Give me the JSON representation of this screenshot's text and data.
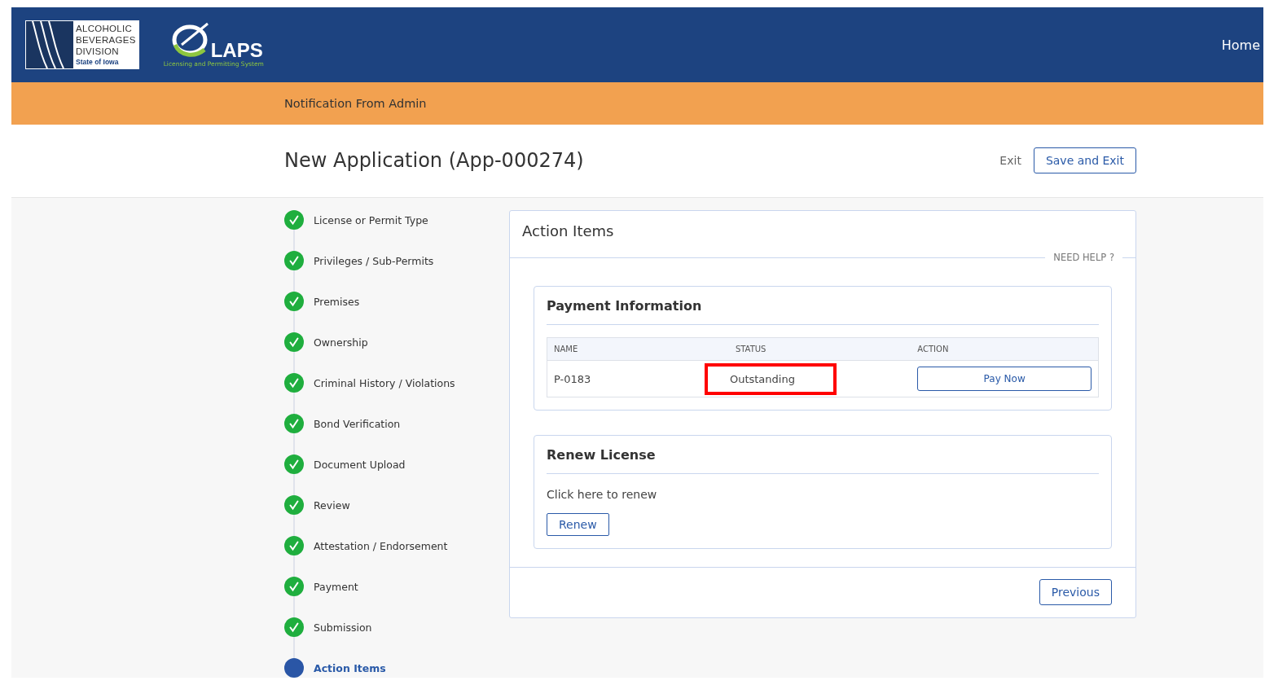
{
  "header": {
    "agency_logo": {
      "lines": [
        "ALCOHOLIC",
        "BEVERAGES",
        "DIVISION"
      ],
      "state": "State of Iowa"
    },
    "laps_logo": {
      "name": "LAPS",
      "tagline": "Licensing and Permitting System"
    },
    "nav": [
      "Home"
    ]
  },
  "notification": "Notification From Admin",
  "page_title": "New Application (App-000274)",
  "title_actions": [
    {
      "label": "Exit",
      "kind": "link"
    },
    {
      "label": "Save and Exit",
      "kind": "outline"
    }
  ],
  "steps": [
    {
      "label": "License or Permit Type",
      "completed": true,
      "selected": false
    },
    {
      "label": "Privileges / Sub-Permits",
      "completed": true,
      "selected": false
    },
    {
      "label": "Premises",
      "completed": true,
      "selected": false
    },
    {
      "label": "Ownership",
      "completed": true,
      "selected": false
    },
    {
      "label": "Criminal History / Violations",
      "completed": true,
      "selected": false
    },
    {
      "label": "Bond Verification",
      "completed": true,
      "selected": false
    },
    {
      "label": "Document Upload",
      "completed": true,
      "selected": false
    },
    {
      "label": "Review",
      "completed": true,
      "selected": false
    },
    {
      "label": "Attestation / Endorsement",
      "completed": true,
      "selected": false
    },
    {
      "label": "Payment",
      "completed": true,
      "selected": false
    },
    {
      "label": "Submission",
      "completed": true,
      "selected": false
    },
    {
      "label": "Action Items",
      "completed": false,
      "selected": true
    }
  ],
  "panel": {
    "title": "Action Items",
    "help": "NEED HELP ?",
    "payment": {
      "title": "Payment Information",
      "columns": [
        "NAME",
        "STATUS",
        "ACTION"
      ],
      "rows": [
        {
          "name": "P-0183",
          "status": "Outstanding",
          "status_highlighted": true,
          "action": "Pay Now"
        }
      ]
    },
    "renew": {
      "title": "Renew License",
      "text": "Click here to renew",
      "button": "Renew"
    },
    "footer_button": "Previous"
  }
}
